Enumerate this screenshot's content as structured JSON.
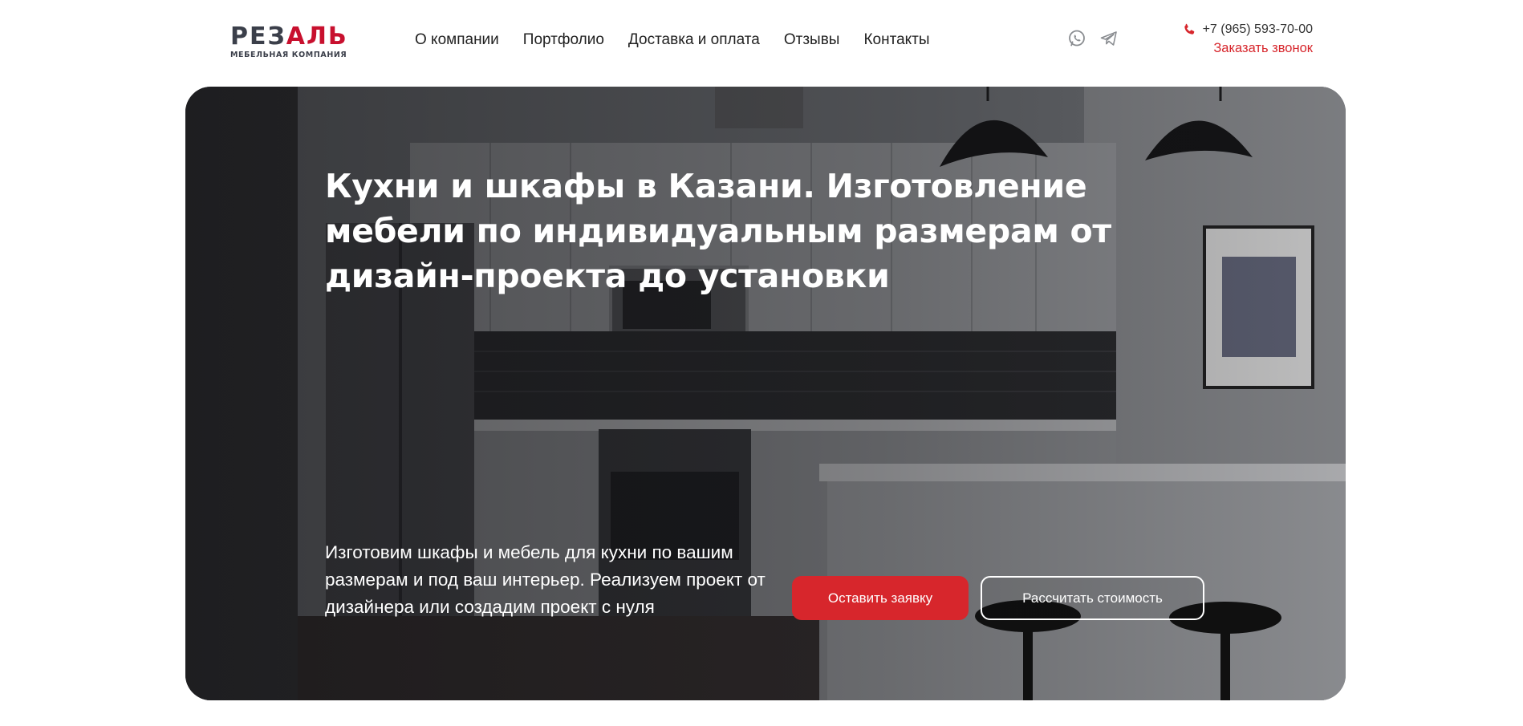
{
  "brand": {
    "logo_dark": "РЕЗ",
    "logo_red": "АЛЬ",
    "logo_sub": "МЕБЕЛЬНАЯ КОМПАНИЯ",
    "accent_color": "#d7262c",
    "logo_dark_color": "#3b3f4a"
  },
  "nav": {
    "items": [
      "О компании",
      "Портфолио",
      "Доставка и оплата",
      "Отзывы",
      "Контакты"
    ]
  },
  "socials": {
    "whatsapp_icon": "whatsapp-icon",
    "telegram_icon": "telegram-icon"
  },
  "contact": {
    "phone": "+7 (965) 593-70-00",
    "callback": "Заказать звонок"
  },
  "hero": {
    "title": "Кухни и шкафы в Казани. Изготовление мебели по индивидуальным размерам от дизайн-проекта до установки",
    "description": "Изготовим шкафы и мебель для кухни по вашим размерам и под ваш интерьер. Реализуем проект от дизайнера или создадим проект с нуля",
    "primary_button": "Оставить заявку",
    "secondary_button": "Рассчитать стоимость"
  }
}
